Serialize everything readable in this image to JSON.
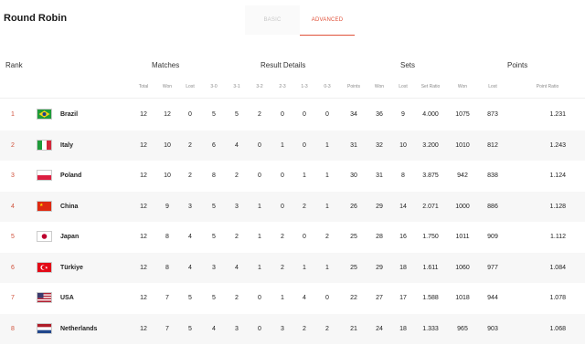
{
  "title": "Round Robin",
  "tabs": {
    "basic": "BASIC",
    "advanced": "ADVANCED"
  },
  "groups": {
    "rank": "Rank",
    "matches": "Matches",
    "results": "Result Details",
    "sets": "Sets",
    "points": "Points"
  },
  "columns": [
    "Total",
    "Won",
    "Lost",
    "3-0",
    "3-1",
    "3-2",
    "2-3",
    "1-3",
    "0-3",
    "Points",
    "Won",
    "Lost",
    "Set Ratio",
    "Won",
    "Lost",
    "Point Ratio"
  ],
  "rows": [
    {
      "rank": "1",
      "team": "Brazil",
      "flag": "brazil-flag-icon",
      "v": [
        "12",
        "12",
        "0",
        "5",
        "5",
        "2",
        "0",
        "0",
        "0",
        "34",
        "36",
        "9",
        "4.000",
        "1075",
        "873",
        "1.231"
      ]
    },
    {
      "rank": "2",
      "team": "Italy",
      "flag": "italy-flag-icon",
      "v": [
        "12",
        "10",
        "2",
        "6",
        "4",
        "0",
        "1",
        "0",
        "1",
        "31",
        "32",
        "10",
        "3.200",
        "1010",
        "812",
        "1.243"
      ]
    },
    {
      "rank": "3",
      "team": "Poland",
      "flag": "poland-flag-icon",
      "v": [
        "12",
        "10",
        "2",
        "8",
        "2",
        "0",
        "0",
        "1",
        "1",
        "30",
        "31",
        "8",
        "3.875",
        "942",
        "838",
        "1.124"
      ]
    },
    {
      "rank": "4",
      "team": "China",
      "flag": "china-flag-icon",
      "v": [
        "12",
        "9",
        "3",
        "5",
        "3",
        "1",
        "0",
        "2",
        "1",
        "26",
        "29",
        "14",
        "2.071",
        "1000",
        "886",
        "1.128"
      ]
    },
    {
      "rank": "5",
      "team": "Japan",
      "flag": "japan-flag-icon",
      "v": [
        "12",
        "8",
        "4",
        "5",
        "2",
        "1",
        "2",
        "0",
        "2",
        "25",
        "28",
        "16",
        "1.750",
        "1011",
        "909",
        "1.112"
      ]
    },
    {
      "rank": "6",
      "team": "Türkiye",
      "flag": "turkey-flag-icon",
      "v": [
        "12",
        "8",
        "4",
        "3",
        "4",
        "1",
        "2",
        "1",
        "1",
        "25",
        "29",
        "18",
        "1.611",
        "1060",
        "977",
        "1.084"
      ]
    },
    {
      "rank": "7",
      "team": "USA",
      "flag": "usa-flag-icon",
      "v": [
        "12",
        "7",
        "5",
        "5",
        "2",
        "0",
        "1",
        "4",
        "0",
        "22",
        "27",
        "17",
        "1.588",
        "1018",
        "944",
        "1.078"
      ]
    },
    {
      "rank": "8",
      "team": "Netherlands",
      "flag": "netherlands-flag-icon",
      "v": [
        "12",
        "7",
        "5",
        "4",
        "3",
        "0",
        "3",
        "2",
        "2",
        "21",
        "24",
        "18",
        "1.333",
        "965",
        "903",
        "1.068"
      ]
    }
  ]
}
